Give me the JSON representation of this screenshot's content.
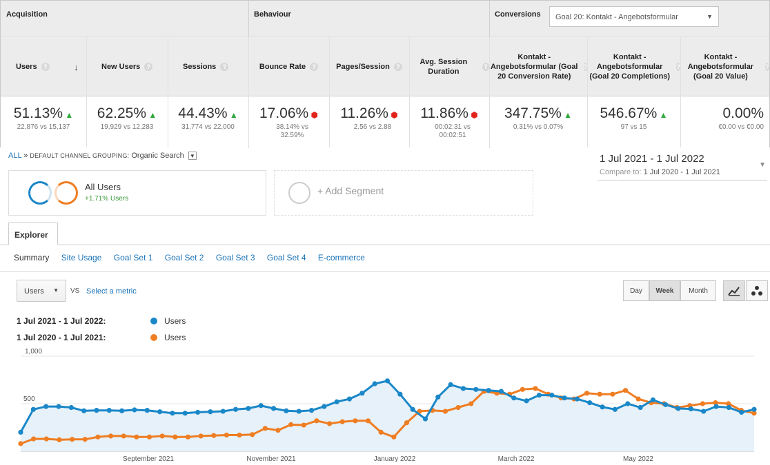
{
  "groups": {
    "acquisition": "Acquisition",
    "behaviour": "Behaviour",
    "conversions": "Conversions",
    "goal_select": "Goal 20: Kontakt - Angebotsformular"
  },
  "columns": [
    {
      "header": "Users",
      "value": "51.13%",
      "sub": "22,876 vs 15,137",
      "trend": "up"
    },
    {
      "header": "New Users",
      "value": "62.25%",
      "sub": "19,929 vs 12,283",
      "trend": "up"
    },
    {
      "header": "Sessions",
      "value": "44.43%",
      "sub": "31,774 vs 22,000",
      "trend": "up"
    },
    {
      "header": "Bounce Rate",
      "value": "17.06%",
      "sub": "38.14% vs 32.59%",
      "trend": "down"
    },
    {
      "header": "Pages/Session",
      "value": "11.26%",
      "sub": "2.56 vs 2.88",
      "trend": "down"
    },
    {
      "header": "Avg. Session Duration",
      "value": "11.86%",
      "sub": "00:02:31 vs 00:02:51",
      "trend": "down"
    },
    {
      "header": "Kontakt - Angebotsformular (Goal 20 Conversion Rate)",
      "value": "347.75%",
      "sub": "0.31% vs 0.07%",
      "trend": "up"
    },
    {
      "header": "Kontakt - Angebotsformular (Goal 20 Completions)",
      "value": "546.67%",
      "sub": "97 vs 15",
      "trend": "up"
    },
    {
      "header": "Kontakt - Angebotsformular (Goal 20 Value)",
      "value": "0.00%",
      "sub": "€0.00 vs €0.00",
      "trend": "none"
    }
  ],
  "breadcrumb": {
    "all": "ALL",
    "sep": "»",
    "grouping": "DEFAULT CHANNEL GROUPING:",
    "value": "Organic Search"
  },
  "date_range": {
    "main": "1 Jul 2021 - 1 Jul 2022",
    "compare_label": "Compare to:",
    "compare_value": "1 Jul 2020 - 1 Jul 2021"
  },
  "segments": {
    "all_users": "All Users",
    "all_users_sub": "+1.71% Users",
    "add_segment": "+ Add Segment"
  },
  "explorer": {
    "tab": "Explorer",
    "subtabs": [
      "Summary",
      "Site Usage",
      "Goal Set 1",
      "Goal Set 2",
      "Goal Set 3",
      "Goal Set 4",
      "E-commerce"
    ]
  },
  "controls": {
    "metric": "Users",
    "vs": "VS",
    "select_metric": "Select a metric",
    "day": "Day",
    "week": "Week",
    "month": "Month",
    "line_icon": "line-chart-icon",
    "motion_icon": "motion-chart-icon"
  },
  "legend": [
    {
      "range": "1 Jul 2021 - 1 Jul 2022:",
      "metric": "Users",
      "color": "#1a87c8"
    },
    {
      "range": "1 Jul 2020 - 1 Jul 2021:",
      "metric": "Users",
      "color": "#ef7d22"
    }
  ],
  "chart_data": {
    "type": "line",
    "y_tick_labels": [
      "1,000",
      "500"
    ],
    "ylim": [
      0,
      1000
    ],
    "x_tick_labels": [
      "September 2021",
      "November 2021",
      "January 2022",
      "March 2022",
      "May 2022"
    ],
    "series": [
      {
        "name": "1 Jul 2021 - 1 Jul 2022: Users",
        "color": "#1a87c8",
        "values": [
          200,
          440,
          470,
          470,
          460,
          425,
          430,
          430,
          425,
          435,
          430,
          415,
          400,
          400,
          410,
          415,
          420,
          440,
          450,
          480,
          450,
          425,
          420,
          430,
          470,
          520,
          550,
          610,
          710,
          740,
          600,
          440,
          340,
          570,
          700,
          660,
          650,
          640,
          630,
          560,
          530,
          590,
          590,
          560,
          550,
          510,
          465,
          440,
          500,
          460,
          540,
          490,
          450,
          445,
          420,
          470,
          460,
          410,
          440
        ]
      },
      {
        "name": "1 Jul 2020 - 1 Jul 2021: Users",
        "color": "#ef7d22",
        "values": [
          80,
          130,
          130,
          120,
          125,
          125,
          150,
          160,
          160,
          150,
          150,
          160,
          150,
          150,
          160,
          165,
          170,
          170,
          175,
          240,
          220,
          280,
          275,
          320,
          290,
          310,
          320,
          320,
          200,
          150,
          300,
          420,
          430,
          420,
          460,
          500,
          630,
          610,
          600,
          650,
          660,
          600,
          560,
          550,
          610,
          600,
          600,
          640,
          550,
          510,
          500,
          460,
          480,
          500,
          510,
          500,
          430,
          400
        ]
      }
    ]
  }
}
